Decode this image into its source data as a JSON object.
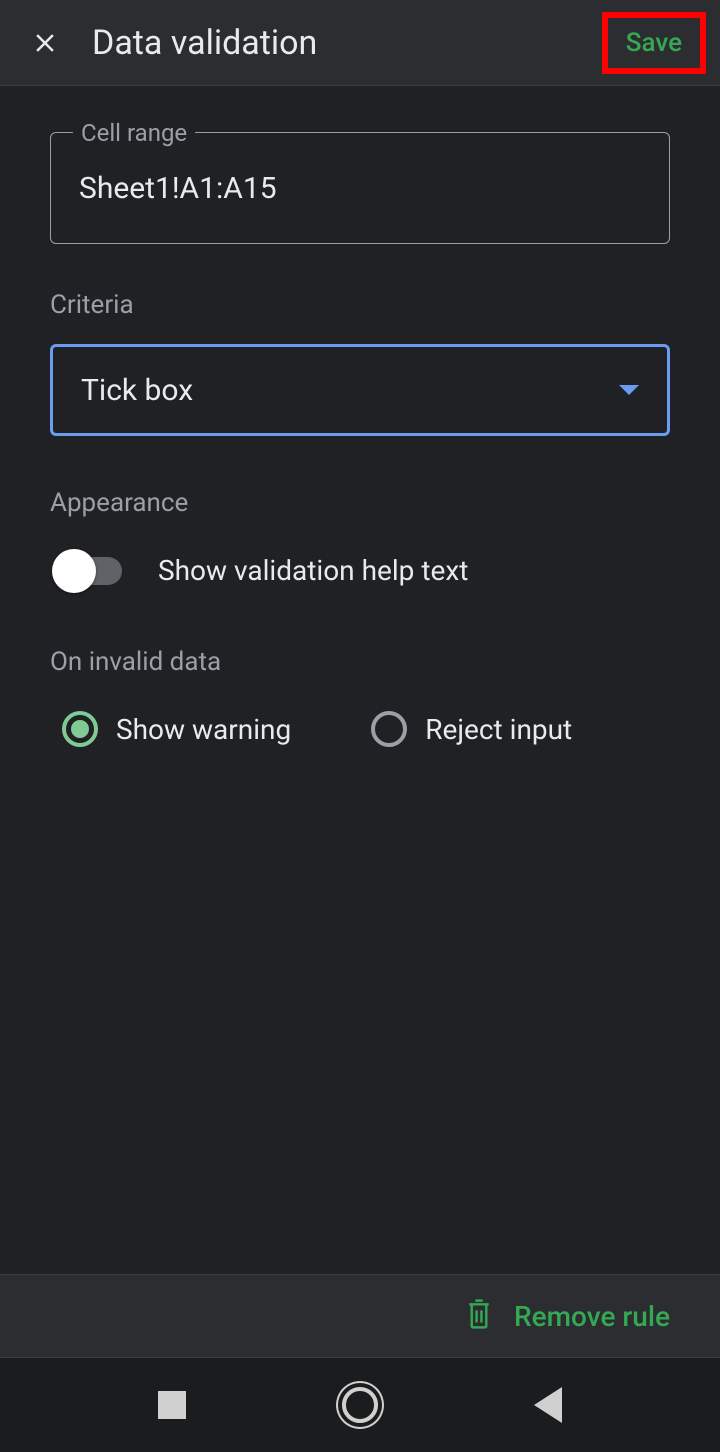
{
  "header": {
    "title": "Data validation",
    "save_label": "Save"
  },
  "cell_range": {
    "label": "Cell range",
    "value": "Sheet1!A1:A15"
  },
  "criteria": {
    "label": "Criteria",
    "selected": "Tick box"
  },
  "appearance": {
    "label": "Appearance",
    "help_text_label": "Show validation help text",
    "help_text_enabled": false
  },
  "on_invalid": {
    "label": "On invalid data",
    "options": [
      {
        "label": "Show warning",
        "selected": true
      },
      {
        "label": "Reject input",
        "selected": false
      }
    ]
  },
  "footer": {
    "remove_label": "Remove rule"
  }
}
